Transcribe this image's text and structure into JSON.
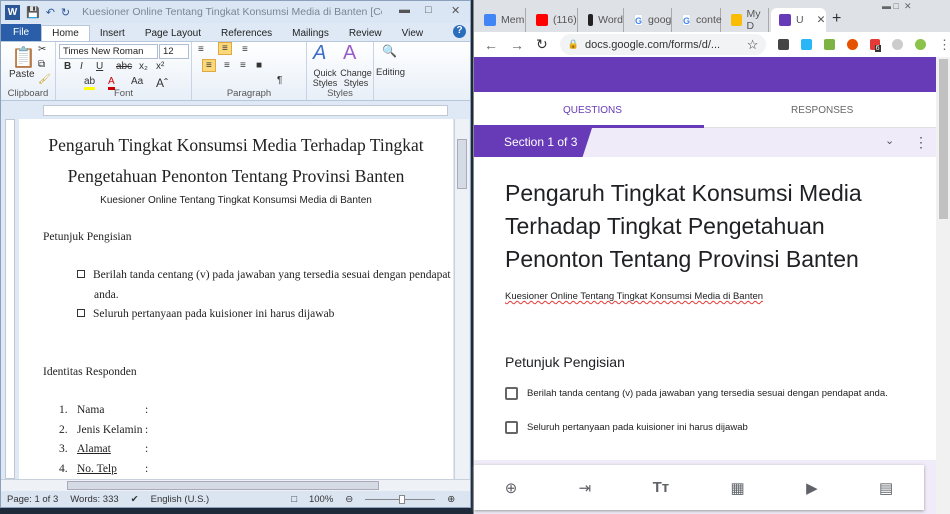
{
  "word": {
    "title": "Kuesioner Online Tentang Tingkat Konsumsi Media di Banten [Compatibility ...",
    "tabs": [
      "File",
      "Home",
      "Insert",
      "Page Layout",
      "References",
      "Mailings",
      "Review",
      "View"
    ],
    "font_name": "Times New Roman",
    "font_size": "12",
    "groups": {
      "clipboard": "Clipboard",
      "font": "Font",
      "paragraph": "Paragraph",
      "styles": "Styles"
    },
    "paste": "Paste",
    "quick_styles": "Quick Styles",
    "change_styles": "Change Styles",
    "editing": "Editing",
    "doc": {
      "title_line1": "Pengaruh Tingkat Konsumsi Media Terhadap Tingkat",
      "title_line2": "Pengetahuan Penonton Tentang Provinsi Banten",
      "subtitle": "Kuesioner Online Tentang Tingkat Konsumsi Media di Banten",
      "instructions_heading": "Petunjuk Pengisian",
      "bullet1_a": "Berilah tanda centang (v) pada jawaban yang tersedia sesuai dengan pendapat",
      "bullet1_b": "anda.",
      "bullet2": "Seluruh pertanyaan pada kuisioner ini harus dijawab",
      "identity_heading": "Identitas Responden",
      "fields": [
        {
          "n": "1.",
          "label": "Nama"
        },
        {
          "n": "2.",
          "label": "Jenis Kelamin"
        },
        {
          "n": "3.",
          "label": "Alamat"
        },
        {
          "n": "4.",
          "label": "No. Telp"
        }
      ],
      "colon": ":"
    },
    "status": {
      "page": "Page: 1 of 3",
      "words": "Words: 333",
      "language": "English (U.S.)",
      "zoom": "100%"
    }
  },
  "chrome": {
    "tabs": [
      {
        "label": "Mem",
        "color": "#4285f4"
      },
      {
        "label": "(116)",
        "color": "#ff0000"
      },
      {
        "label": "Word",
        "color": "#222222"
      },
      {
        "label": "goog",
        "color": "#ffffff"
      },
      {
        "label": "conte",
        "color": "#ffffff"
      },
      {
        "label": "My D",
        "color": "#fbbc04"
      },
      {
        "label": "U",
        "color": "#673ab7"
      }
    ],
    "new_tab": "+",
    "url": "docs.google.com/forms/d/...",
    "ext_badge": "6",
    "form": {
      "accent": "#673ab7",
      "tab_questions": "QUESTIONS",
      "tab_responses": "RESPONSES",
      "section": "Section 1 of 3",
      "title": "Pengaruh Tingkat Konsumsi Media Terhadap Tingkat Pengetahuan Penonton Tentang Provinsi Banten",
      "description": "Kuesioner Online Tentang Tingkat Konsumsi Media di Banten",
      "question": "Petunjuk Pengisian",
      "options": [
        "Berilah tanda centang (v) pada jawaban yang tersedia sesuai dengan pendapat anda.",
        "Seluruh pertanyaan pada kuisioner ini harus dijawab"
      ]
    }
  }
}
